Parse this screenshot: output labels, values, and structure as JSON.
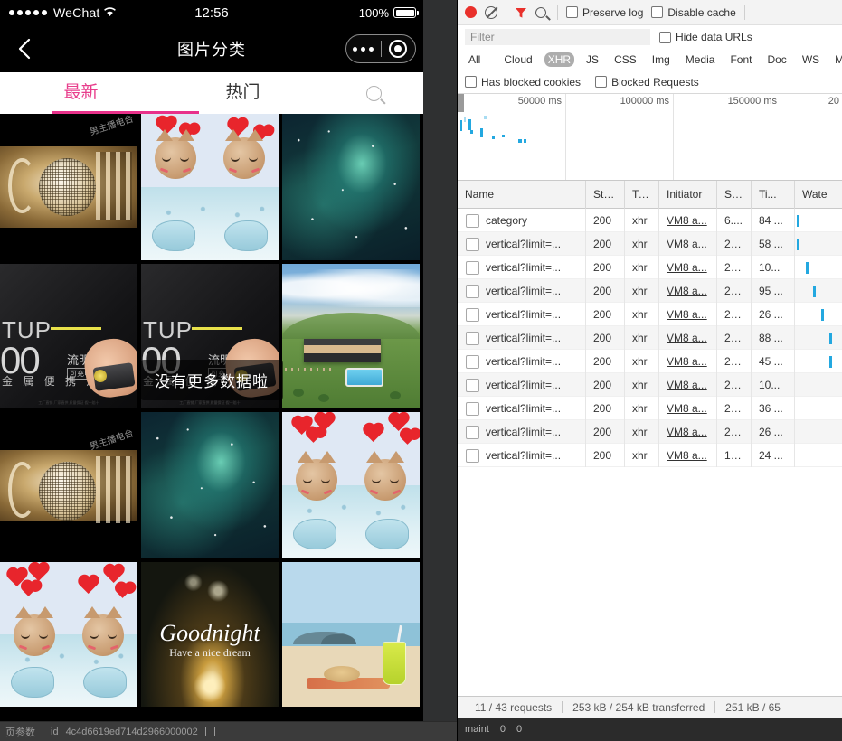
{
  "phone": {
    "status_bar": {
      "carrier": "WeChat",
      "signal_dots": 5,
      "wifi_icon": "wifi-icon",
      "time": "12:56",
      "battery_percent": "100%",
      "battery_icon": "battery-full-icon"
    },
    "nav_bar": {
      "back_icon": "chevron-left-icon",
      "title": "图片分类",
      "more_icon": "more-dots-icon",
      "capsule_target_icon": "target-icon"
    },
    "tabs": [
      {
        "label": "最新",
        "active": true
      },
      {
        "label": "热门",
        "active": false
      }
    ],
    "search_icon": "search-icon",
    "accent_color": "#e8318a",
    "toast": "没有更多数据啦",
    "grid": [
      {
        "art": "mic",
        "watermark": "男主播电台"
      },
      {
        "art": "cats",
        "watermark": ""
      },
      {
        "art": "galaxy",
        "watermark": ""
      },
      {
        "art": "torch",
        "title": "TUP",
        "zeros": "00",
        "lumen": "流明",
        "badge": "可充电",
        "sub": "金 属 便 携 灯",
        "fine": "工厂直销 厂家直供 质量保证 假一赔十"
      },
      {
        "art": "torch",
        "title": "TUP",
        "zeros": "00",
        "lumen": "流明",
        "badge": "可充电",
        "sub": "金 属 便 携 灯",
        "fine": "工厂直销 厂家直供 质量保证 假一赔十"
      },
      {
        "art": "house",
        "watermark": ""
      },
      {
        "art": "mic",
        "watermark": "男主播电台"
      },
      {
        "art": "galaxy",
        "watermark": ""
      },
      {
        "art": "cats",
        "watermark": ""
      },
      {
        "art": "cats",
        "watermark": ""
      },
      {
        "art": "goodnight",
        "title": "Goodnight",
        "subtitle": "Have a nice dream"
      },
      {
        "art": "beach",
        "watermark": ""
      }
    ],
    "bottom_bar": {
      "left_label": "页参数",
      "key": "id",
      "value": "4c4d6619ed714d2966000002",
      "copy_icon": "copy-icon"
    }
  },
  "devtools": {
    "toolbar": {
      "record_icon": "record-icon",
      "clear_icon": "clear-icon",
      "filter_icon": "funnel-icon",
      "search_icon": "search-icon",
      "preserve_log_label": "Preserve log",
      "disable_cache_label": "Disable cache"
    },
    "filter_row": {
      "filter_placeholder": "Filter",
      "filter_value": "",
      "hide_data_urls_label": "Hide data URLs"
    },
    "types": [
      "All",
      "Cloud",
      "XHR",
      "JS",
      "CSS",
      "Img",
      "Media",
      "Font",
      "Doc",
      "WS",
      "M..."
    ],
    "active_type": "XHR",
    "blocked_row": {
      "has_blocked_cookies_label": "Has blocked cookies",
      "blocked_requests_label": "Blocked Requests"
    },
    "overview": {
      "ticks": [
        "50000 ms",
        "100000 ms",
        "150000 ms",
        "20"
      ]
    },
    "columns": [
      "Name",
      "Sta...",
      "Ty...",
      "Initiator",
      "Size",
      "Ti...",
      "Wate"
    ],
    "rows": [
      {
        "name": "category",
        "status": "200",
        "type": "xhr",
        "initiator": "VM8 a...",
        "size": "6....",
        "time": "84 ...",
        "wf": 2
      },
      {
        "name": "vertical?limit=...",
        "status": "200",
        "type": "xhr",
        "initiator": "VM8 a...",
        "size": "27...",
        "time": "58 ...",
        "wf": 2
      },
      {
        "name": "vertical?limit=...",
        "status": "200",
        "type": "xhr",
        "initiator": "VM8 a...",
        "size": "27...",
        "time": "10...",
        "wf": 12
      },
      {
        "name": "vertical?limit=...",
        "status": "200",
        "type": "xhr",
        "initiator": "VM8 a...",
        "size": "27...",
        "time": "95 ...",
        "wf": 20
      },
      {
        "name": "vertical?limit=...",
        "status": "200",
        "type": "xhr",
        "initiator": "VM8 a...",
        "size": "27...",
        "time": "26 ...",
        "wf": 29
      },
      {
        "name": "vertical?limit=...",
        "status": "200",
        "type": "xhr",
        "initiator": "VM8 a...",
        "size": "27...",
        "time": "88 ...",
        "wf": 38
      },
      {
        "name": "vertical?limit=...",
        "status": "200",
        "type": "xhr",
        "initiator": "VM8 a...",
        "size": "27...",
        "time": "45 ...",
        "wf": 38
      },
      {
        "name": "vertical?limit=...",
        "status": "200",
        "type": "xhr",
        "initiator": "VM8 a...",
        "size": "27...",
        "time": "10...",
        "wf": -1
      },
      {
        "name": "vertical?limit=...",
        "status": "200",
        "type": "xhr",
        "initiator": "VM8 a...",
        "size": "27...",
        "time": "36 ...",
        "wf": -1
      },
      {
        "name": "vertical?limit=...",
        "status": "200",
        "type": "xhr",
        "initiator": "VM8 a...",
        "size": "27...",
        "time": "26 ...",
        "wf": -1
      },
      {
        "name": "vertical?limit=...",
        "status": "200",
        "type": "xhr",
        "initiator": "VM8 a...",
        "size": "17...",
        "time": "24 ...",
        "wf": -1
      }
    ],
    "status_bar": {
      "requests": "11 / 43 requests",
      "transferred": "253 kB / 254 kB transferred",
      "resources": "251 kB / 65"
    },
    "console_bar": {
      "maint_label": "maint",
      "errors": "0",
      "warnings": "0"
    }
  }
}
